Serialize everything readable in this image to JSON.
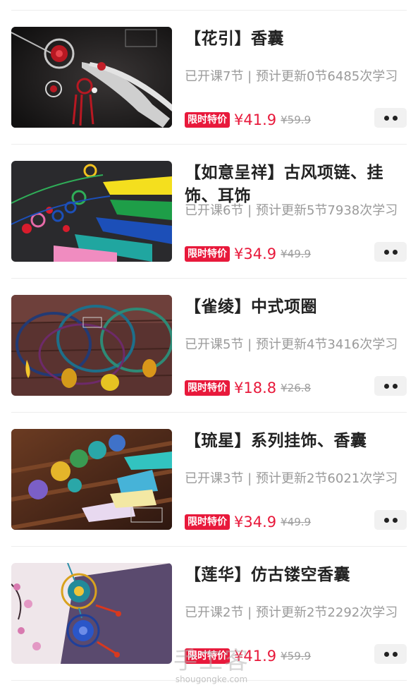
{
  "courses": [
    {
      "title": "【花引】香囊",
      "meta": "已开课7节 | 预计更新0节6485次学习",
      "badge": "限时特价",
      "price": "¥41.9",
      "original_price": "¥59.9",
      "thumb_theme": "dark-red-tassel"
    },
    {
      "title": "【如意呈祥】古风项链、挂饰、耳饰",
      "meta": "已开课6节 | 预计更新5节7938次学习",
      "badge": "限时特价",
      "price": "¥34.9",
      "original_price": "¥49.9",
      "thumb_theme": "colorful-tassels"
    },
    {
      "title": "【雀绫】中式项圈",
      "meta": "已开课5节 | 预计更新4节3416次学习",
      "badge": "限时特价",
      "price": "¥18.8",
      "original_price": "¥26.8",
      "thumb_theme": "choker-rings"
    },
    {
      "title": "【琉星】系列挂饰、香囊",
      "meta": "已开课3节 | 预计更新2节6021次学习",
      "badge": "限时特价",
      "price": "¥34.9",
      "original_price": "¥49.9",
      "thumb_theme": "rainbow-pendants"
    },
    {
      "title": "【莲华】仿古镂空香囊",
      "meta": "已开课2节 | 预计更新2节2292次学习",
      "badge": "限时特价",
      "price": "¥41.9",
      "original_price": "¥59.9",
      "thumb_theme": "blue-lotus-sachet"
    }
  ],
  "more_icon": "more-dots-icon",
  "watermark": {
    "main": "手工客",
    "sub": "shougongke.com"
  },
  "colors": {
    "accent_red": "#e8193b",
    "title_text": "#222222",
    "meta_text": "#9a9a9a",
    "divider": "#ededed",
    "more_button_bg": "#f1f1f1"
  }
}
